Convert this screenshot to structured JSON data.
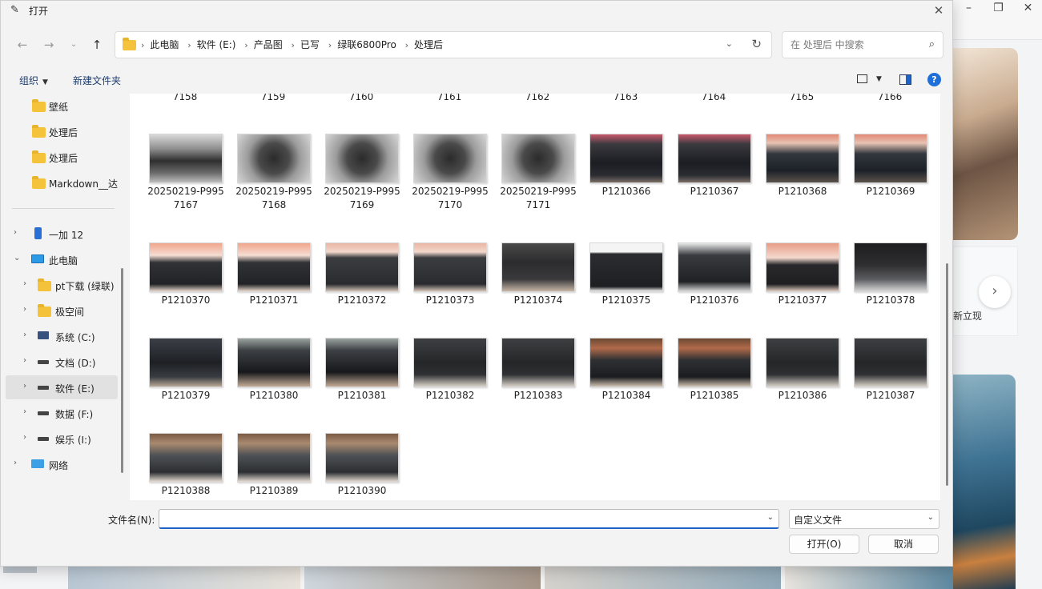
{
  "dialog": {
    "title": "打开"
  },
  "nav": {
    "breadcrumbs": [
      "此电脑",
      "软件 (E:)",
      "产品图",
      "已写",
      "绿联6800Pro",
      "处理后"
    ],
    "search_placeholder": "在 处理后 中搜索"
  },
  "toolbar": {
    "organize": "组织",
    "new_folder": "新建文件夹"
  },
  "sidebar": {
    "quick": [
      "壁纸",
      "处理后",
      "处理后",
      "Markdown__达"
    ],
    "device": "一加 12",
    "pc": "此电脑",
    "drives": [
      "pt下载 (绿联)",
      "极空间",
      "系统 (C:)",
      "文档 (D:)",
      "软件 (E:)",
      "数据 (F:)",
      "娱乐 (I:)"
    ],
    "network": "网络"
  },
  "files": {
    "cut_row": [
      "7158",
      "7159",
      "7160",
      "7161",
      "7162",
      "7163",
      "7164",
      "7165",
      "7166"
    ],
    "rows": [
      [
        {
          "l1": "20250219-P995",
          "l2": "7167",
          "s": "t-gray"
        },
        {
          "l1": "20250219-P995",
          "l2": "7168",
          "s": "t-gray2"
        },
        {
          "l1": "20250219-P995",
          "l2": "7169",
          "s": "t-gray2"
        },
        {
          "l1": "20250219-P995",
          "l2": "7170",
          "s": "t-gray2"
        },
        {
          "l1": "20250219-P995",
          "l2": "7171",
          "s": "t-gray2"
        },
        {
          "l1": "P1210366",
          "l2": "",
          "s": "t-box"
        },
        {
          "l1": "P1210367",
          "l2": "",
          "s": "t-box"
        },
        {
          "l1": "P1210368",
          "l2": "",
          "s": "t-box2"
        },
        {
          "l1": "P1210369",
          "l2": "",
          "s": "t-box2"
        }
      ],
      [
        {
          "l1": "P1210370",
          "l2": "",
          "s": "t-nasfront"
        },
        {
          "l1": "P1210371",
          "l2": "",
          "s": "t-nasfront"
        },
        {
          "l1": "P1210372",
          "l2": "",
          "s": "t-nasback"
        },
        {
          "l1": "P1210373",
          "l2": "",
          "s": "t-nasback"
        },
        {
          "l1": "P1210374",
          "l2": "",
          "s": "t-dark"
        },
        {
          "l1": "P1210375",
          "l2": "",
          "s": "t-ports"
        },
        {
          "l1": "P1210376",
          "l2": "",
          "s": "t-ports2"
        },
        {
          "l1": "P1210377",
          "l2": "",
          "s": "t-cube"
        },
        {
          "l1": "P1210378",
          "l2": "",
          "s": "t-top"
        }
      ],
      [
        {
          "l1": "P1210379",
          "l2": "",
          "s": "t-drive"
        },
        {
          "l1": "P1210380",
          "l2": "",
          "s": "t-bays"
        },
        {
          "l1": "P1210381",
          "l2": "",
          "s": "t-bays"
        },
        {
          "l1": "P1210382",
          "l2": "",
          "s": "t-dark2"
        },
        {
          "l1": "P1210383",
          "l2": "",
          "s": "t-dark2"
        },
        {
          "l1": "P1210384",
          "l2": "",
          "s": "t-shelf"
        },
        {
          "l1": "P1210385",
          "l2": "",
          "s": "t-shelf"
        },
        {
          "l1": "P1210386",
          "l2": "",
          "s": "t-dark2"
        },
        {
          "l1": "P1210387",
          "l2": "",
          "s": "t-dark2"
        }
      ],
      [
        {
          "l1": "P1210388",
          "l2": "",
          "s": "t-side"
        },
        {
          "l1": "P1210389",
          "l2": "",
          "s": "t-side"
        },
        {
          "l1": "P1210390",
          "l2": "",
          "s": "t-side"
        }
      ]
    ]
  },
  "footer": {
    "filename_label": "文件名(N):",
    "filename_value": "",
    "filetype": "自定义文件",
    "open": "打开(O)",
    "cancel": "取消"
  },
  "background": {
    "side_text": "新立现"
  },
  "colors": {
    "accent": "#1e64c8",
    "folder": "#f5c33b"
  }
}
